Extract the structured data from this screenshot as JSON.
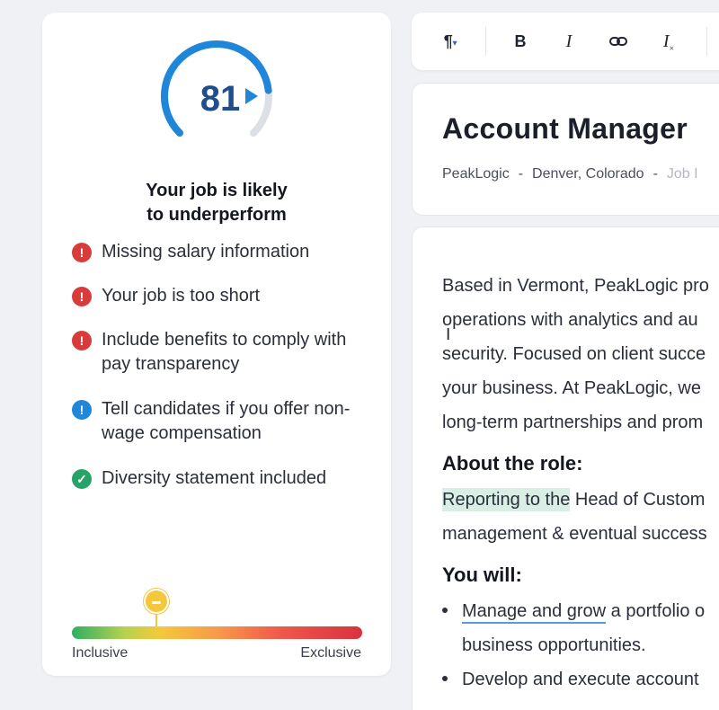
{
  "score_panel": {
    "score": "81",
    "score_fraction": 0.81,
    "verdict_line1": "Your job is likely",
    "verdict_line2": "to underperform",
    "checks": [
      {
        "text": "Missing salary information",
        "status": "error"
      },
      {
        "text": "Your job is too short",
        "status": "error"
      },
      {
        "text": "Include benefits to comply with pay transparency",
        "status": "error"
      },
      {
        "text": "Tell candidates if you offer non-wage compensation",
        "status": "info"
      },
      {
        "text": "Diversity statement included",
        "status": "ok"
      }
    ],
    "scale": {
      "left_label": "Inclusive",
      "right_label": "Exclusive",
      "marker_fraction": 0.29
    },
    "colors": {
      "gauge_arc": "#1f86d9",
      "gauge_track": "#dcdfe4",
      "error": "#d93b3b",
      "info": "#1f86d9",
      "ok": "#27a367",
      "marker": "#f5c73c"
    }
  },
  "toolbar": {
    "paragraph_icon": "¶",
    "bold_label": "B",
    "italic_label": "I",
    "link_icon": "link-icon",
    "clear_format_label": "I"
  },
  "job": {
    "title": "Account Manager",
    "company": "PeakLogic",
    "location": "Denver, Colorado",
    "extra": "Job I"
  },
  "body": {
    "intro_lines": [
      "Based in Vermont, PeakLogic pro",
      "operations with analytics and au",
      "security. Focused on client succe",
      "your business. At PeakLogic, we",
      "long-term partnerships and prom"
    ],
    "about_heading": "About the role:",
    "about_highlight": "Reporting to the",
    "about_rest": " Head of Custom",
    "about_line2": "management & eventual success",
    "you_will_heading": "You will:",
    "bullet1_underlined": "Manage and grow",
    "bullet1_rest": " a portfolio o",
    "bullet1_line2": "business opportunities.",
    "bullet2": "Develop and execute account"
  }
}
